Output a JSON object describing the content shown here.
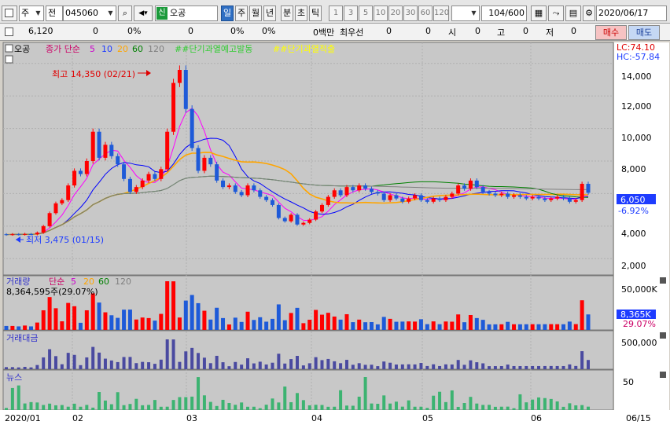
{
  "toolbar": {
    "market": "주",
    "period_type": "전",
    "code": "045060",
    "stock_badge": "신",
    "stock_name": "오공",
    "periods": [
      "일",
      "주",
      "월",
      "년",
      "분",
      "초",
      "틱"
    ],
    "active_period": "일",
    "minute_numbers": [
      "1",
      "3",
      "5",
      "10",
      "20",
      "30",
      "60",
      "120"
    ],
    "count_value": "104",
    "count_total": "/600",
    "date": "2020/06/17"
  },
  "quote": {
    "price": "6,120",
    "change": "0",
    "change_pct": "0%",
    "volume": "0",
    "volume_pct": "0%",
    "amount_pct": "0%",
    "amount_unit": "0백만",
    "best_label": "최우선",
    "best_a": "0",
    "best_b": "0",
    "open_label": "시",
    "open_val": "0",
    "high_label": "고",
    "high_val": "0",
    "low_label": "저",
    "low_val": "0",
    "buy_label": "매수",
    "sell_label": "매도"
  },
  "colors": {
    "up": "#ff0000",
    "down": "#1e5ad8",
    "ma5": "#ff00ff",
    "ma10": "#0000ff",
    "ma20": "#ffa500",
    "ma60": "#008000",
    "ma120": "#808080",
    "volume_bar": "#4a4aa0",
    "news_bar": "#3cb371",
    "chart_bg": "#c8c8c8"
  },
  "chart_data": {
    "type": "candlestick",
    "legend": {
      "name": "오공",
      "price_label": "종가 단순",
      "ma_periods": [
        "5",
        "10",
        "20",
        "60",
        "120"
      ],
      "signal1": "##단기과열예고발동",
      "signal2": "##단기과열적출"
    },
    "right_labels": {
      "lc": "LC:74.10",
      "hc": "HC:-57.84"
    },
    "y_ticks": [
      "14,000",
      "12,000",
      "10,000",
      "8,000",
      "4,000",
      "2,000"
    ],
    "y_range": [
      1000,
      15000
    ],
    "current_price": "6,050",
    "current_pct": "-6.92%",
    "high_annotation": "최고 14,350 (02/21)",
    "low_annotation": "최저 3,475 (01/15)",
    "x_labels": [
      "2020/01",
      "02",
      "03",
      "04",
      "05",
      "06",
      "06/15"
    ],
    "candles": [
      {
        "o": 3500,
        "c": 3480
      },
      {
        "o": 3480,
        "c": 3500
      },
      {
        "o": 3500,
        "c": 3490
      },
      {
        "o": 3490,
        "c": 3520
      },
      {
        "o": 3510,
        "c": 3500
      },
      {
        "o": 3500,
        "c": 3600
      },
      {
        "o": 3600,
        "c": 4000
      },
      {
        "o": 4000,
        "c": 4800
      },
      {
        "o": 4800,
        "c": 5400
      },
      {
        "o": 5400,
        "c": 5600
      },
      {
        "o": 5600,
        "c": 6500
      },
      {
        "o": 6500,
        "c": 7400
      },
      {
        "o": 7400,
        "c": 7200
      },
      {
        "o": 7200,
        "c": 8000
      },
      {
        "o": 8000,
        "c": 9800
      },
      {
        "o": 9800,
        "c": 8200
      },
      {
        "o": 8200,
        "c": 9000
      },
      {
        "o": 9000,
        "c": 8300
      },
      {
        "o": 8300,
        "c": 7800
      },
      {
        "o": 7800,
        "c": 6900
      },
      {
        "o": 6900,
        "c": 6100
      },
      {
        "o": 6100,
        "c": 6400
      },
      {
        "o": 6400,
        "c": 6800
      },
      {
        "o": 6800,
        "c": 7200
      },
      {
        "o": 7200,
        "c": 6900
      },
      {
        "o": 6900,
        "c": 7500
      },
      {
        "o": 7500,
        "c": 9800
      },
      {
        "o": 9800,
        "c": 12800
      },
      {
        "o": 12800,
        "c": 13600
      },
      {
        "o": 13600,
        "c": 11200
      },
      {
        "o": 11200,
        "c": 8800
      },
      {
        "o": 8800,
        "c": 7400
      },
      {
        "o": 7400,
        "c": 8200
      },
      {
        "o": 8200,
        "c": 7800
      },
      {
        "o": 7800,
        "c": 6800
      },
      {
        "o": 6800,
        "c": 6400
      },
      {
        "o": 6400,
        "c": 6500
      },
      {
        "o": 6500,
        "c": 6100
      },
      {
        "o": 6100,
        "c": 5900
      },
      {
        "o": 5900,
        "c": 6500
      },
      {
        "o": 6500,
        "c": 6200
      },
      {
        "o": 6200,
        "c": 5800
      },
      {
        "o": 5800,
        "c": 5600
      },
      {
        "o": 5600,
        "c": 5300
      },
      {
        "o": 5300,
        "c": 4500
      },
      {
        "o": 4500,
        "c": 4300
      },
      {
        "o": 4300,
        "c": 4700
      },
      {
        "o": 4700,
        "c": 4100
      },
      {
        "o": 4100,
        "c": 4200
      },
      {
        "o": 4200,
        "c": 4400
      },
      {
        "o": 4400,
        "c": 4900
      },
      {
        "o": 4900,
        "c": 5300
      },
      {
        "o": 5300,
        "c": 5800
      },
      {
        "o": 5800,
        "c": 6200
      },
      {
        "o": 6200,
        "c": 5900
      },
      {
        "o": 5900,
        "c": 6400
      },
      {
        "o": 6400,
        "c": 6200
      },
      {
        "o": 6200,
        "c": 6500
      },
      {
        "o": 6500,
        "c": 6300
      },
      {
        "o": 6300,
        "c": 6100
      },
      {
        "o": 6100,
        "c": 6000
      },
      {
        "o": 6000,
        "c": 5600
      },
      {
        "o": 5600,
        "c": 5900
      },
      {
        "o": 5900,
        "c": 5700
      },
      {
        "o": 5700,
        "c": 5500
      },
      {
        "o": 5500,
        "c": 5700
      },
      {
        "o": 5700,
        "c": 5900
      },
      {
        "o": 5900,
        "c": 5600
      },
      {
        "o": 5600,
        "c": 5500
      },
      {
        "o": 5500,
        "c": 5700
      },
      {
        "o": 5700,
        "c": 5600
      },
      {
        "o": 5600,
        "c": 5800
      },
      {
        "o": 5800,
        "c": 6000
      },
      {
        "o": 6000,
        "c": 6500
      },
      {
        "o": 6500,
        "c": 6300
      },
      {
        "o": 6300,
        "c": 6800
      },
      {
        "o": 6800,
        "c": 6400
      },
      {
        "o": 6400,
        "c": 6100
      },
      {
        "o": 6100,
        "c": 6000
      },
      {
        "o": 6000,
        "c": 5900
      },
      {
        "o": 5900,
        "c": 6000
      },
      {
        "o": 6000,
        "c": 5800
      },
      {
        "o": 5800,
        "c": 5900
      },
      {
        "o": 5900,
        "c": 5800
      },
      {
        "o": 5800,
        "c": 5700
      },
      {
        "o": 5700,
        "c": 5800
      },
      {
        "o": 5800,
        "c": 5700
      },
      {
        "o": 5700,
        "c": 5600
      },
      {
        "o": 5600,
        "c": 5700
      },
      {
        "o": 5700,
        "c": 5800
      },
      {
        "o": 5800,
        "c": 5700
      },
      {
        "o": 5700,
        "c": 5500
      },
      {
        "o": 5500,
        "c": 5600
      },
      {
        "o": 5600,
        "c": 6600
      },
      {
        "o": 6600,
        "c": 6050
      }
    ],
    "volume_panel": {
      "label": "거래량",
      "ma_label": "단순",
      "ma_periods": [
        "5",
        "20",
        "60",
        "120"
      ],
      "summary": "8,364,595주(29.07%)",
      "y_tick": "50,000K",
      "current": "8,365K",
      "current_pct": "29.07%"
    },
    "amount_panel": {
      "label": "거래대금",
      "y_tick": "500,000"
    },
    "news_panel": {
      "label": "뉴스",
      "y_tick": "50"
    }
  }
}
